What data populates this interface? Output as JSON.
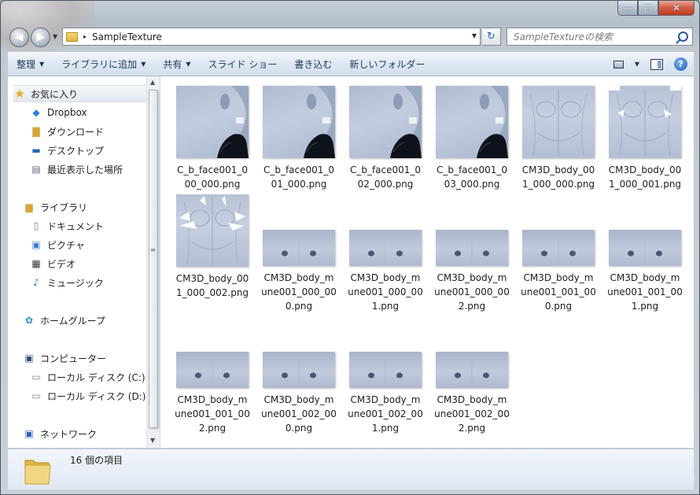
{
  "window": {
    "minimize_glyph": "—",
    "maximize_glyph": "□",
    "close_glyph": "✕"
  },
  "address_bar": {
    "folder": "SampleTexture",
    "separator": "▸"
  },
  "search": {
    "placeholder": "SampleTextureの検索"
  },
  "toolbar": {
    "organize": "整理",
    "add_to_library": "ライブラリに追加",
    "share": "共有",
    "slideshow": "スライド ショー",
    "burn": "書き込む",
    "new_folder": "新しいフォルダー"
  },
  "nav": {
    "favorites": "お気に入り",
    "dropbox": "Dropbox",
    "downloads": "ダウンロード",
    "desktop": "デスクトップ",
    "recent": "最近表示した場所",
    "libraries": "ライブラリ",
    "documents": "ドキュメント",
    "pictures": "ピクチャ",
    "videos": "ビデオ",
    "music": "ミュージック",
    "homegroup": "ホームグループ",
    "computer": "コンピューター",
    "local_c": "ローカル ディスク (C:)",
    "local_d": "ローカル ディスク (D:)",
    "network": "ネットワーク"
  },
  "files": [
    {
      "name": "C_b_face001_0\n00_000.png",
      "kind": "face"
    },
    {
      "name": "C_b_face001_0\n01_000.png",
      "kind": "face"
    },
    {
      "name": "C_b_face001_0\n02_000.png",
      "kind": "face"
    },
    {
      "name": "C_b_face001_0\n03_000.png",
      "kind": "face"
    },
    {
      "name": "CM3D_body_00\n1_000_000.png",
      "kind": "body"
    },
    {
      "name": "CM3D_body_00\n1_000_001.png",
      "kind": "body"
    },
    {
      "name": "CM3D_body_00\n1_000_002.png",
      "kind": "body"
    },
    {
      "name": "CM3D_body_m\nune001_000_00\n0.png",
      "kind": "mune"
    },
    {
      "name": "CM3D_body_m\nune001_000_00\n1.png",
      "kind": "mune"
    },
    {
      "name": "CM3D_body_m\nune001_000_00\n2.png",
      "kind": "mune"
    },
    {
      "name": "CM3D_body_m\nune001_001_00\n0.png",
      "kind": "mune"
    },
    {
      "name": "CM3D_body_m\nune001_001_00\n1.png",
      "kind": "mune"
    },
    {
      "name": "CM3D_body_m\nune001_001_00\n2.png",
      "kind": "mune"
    },
    {
      "name": "CM3D_body_m\nune001_002_00\n0.png",
      "kind": "mune"
    },
    {
      "name": "CM3D_body_m\nune001_002_00\n1.png",
      "kind": "mune"
    },
    {
      "name": "CM3D_body_m\nune001_002_00\n2.png",
      "kind": "mune"
    }
  ],
  "status": {
    "item_count": "16 個の項目"
  }
}
